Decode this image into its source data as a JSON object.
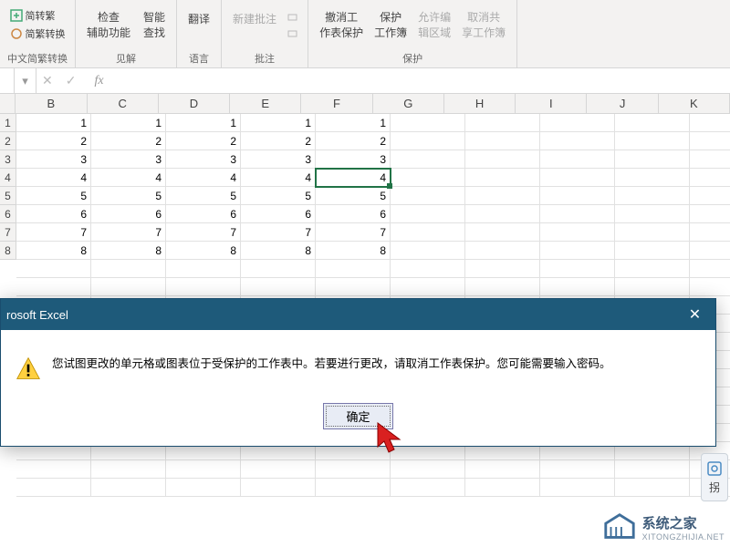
{
  "ribbon": {
    "group1": {
      "item1": "简转繁",
      "item2": "简繁转换",
      "label": "中文简繁转换"
    },
    "group2": {
      "btn1a": "检查",
      "btn1b": "辅助功能",
      "btn2a": "智能",
      "btn2b": "查找",
      "label": "见解"
    },
    "group3": {
      "btn": "翻译",
      "label": "语言"
    },
    "group4": {
      "btn": "新建批注",
      "label": "批注"
    },
    "group5": {
      "btn1a": "撤消工",
      "btn1b": "作表保护",
      "btn2a": "保护",
      "btn2b": "工作簿",
      "btn3a": "允许编",
      "btn3b": "辑区域",
      "btn4a": "取消共",
      "btn4b": "享工作簿",
      "label": "保护"
    }
  },
  "columns": [
    "B",
    "C",
    "D",
    "E",
    "F",
    "G",
    "H",
    "I",
    "J",
    "K"
  ],
  "rows": [
    "1",
    "2",
    "3",
    "4",
    "5",
    "6",
    "7",
    "8"
  ],
  "data": [
    [
      "1",
      "1",
      "1",
      "1",
      "1"
    ],
    [
      "2",
      "2",
      "2",
      "2",
      "2"
    ],
    [
      "3",
      "3",
      "3",
      "3",
      "3"
    ],
    [
      "4",
      "4",
      "4",
      "4",
      "4"
    ],
    [
      "5",
      "5",
      "5",
      "5",
      "5"
    ],
    [
      "6",
      "6",
      "6",
      "6",
      "6"
    ],
    [
      "7",
      "7",
      "7",
      "7",
      "7"
    ],
    [
      "8",
      "8",
      "8",
      "8",
      "8"
    ]
  ],
  "dialog": {
    "title": "rosoft Excel",
    "message": "您试图更改的单元格或图表位于受保护的工作表中。若要进行更改，请取消工作表保护。您可能需要输入密码。",
    "ok": "确定"
  },
  "watermark": {
    "name": "系统之家",
    "url": "XITONGZHIJIA.NET"
  },
  "side": {
    "label": "拐"
  }
}
